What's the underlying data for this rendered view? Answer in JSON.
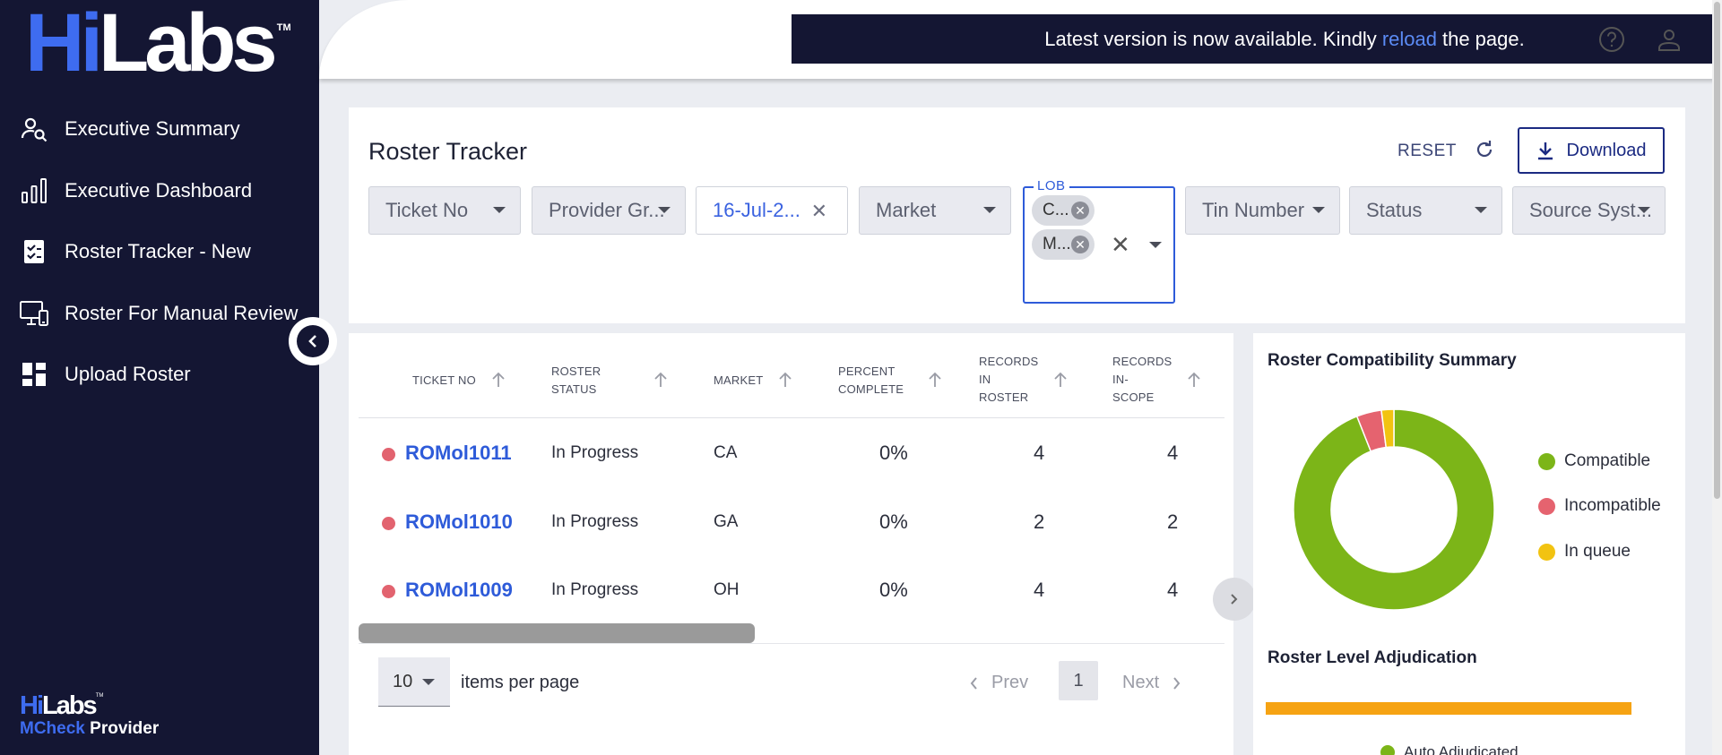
{
  "brand": {
    "logo_hi": "Hi",
    "logo_labs": "Labs",
    "logo_tm": "TM",
    "footer_hi": "Hi",
    "footer_labs": "Labs",
    "footer_tm": "TM",
    "footer_mcheck": "MCheck",
    "footer_provider": "Provider"
  },
  "sidebar": {
    "items": [
      {
        "label": "Executive Summary",
        "icon": "person-search-icon"
      },
      {
        "label": "Executive Dashboard",
        "icon": "bar-chart-icon"
      },
      {
        "label": "Roster Tracker - New",
        "icon": "checklist-icon"
      },
      {
        "label": "Roster For Manual Review",
        "icon": "monitor-icon"
      },
      {
        "label": "Upload Roster",
        "icon": "dashboard-grid-icon"
      }
    ]
  },
  "banner": {
    "text_before": "Latest version is now available. Kindly",
    "link": "reload",
    "text_after": "the page."
  },
  "page": {
    "title": "Roster Tracker",
    "reset_label": "RESET",
    "download_label": "Download"
  },
  "filters": {
    "ticket_no": "Ticket No",
    "provider_group": "Provider Gr...",
    "date": "16-Jul-2...",
    "market": "Market",
    "lob_label": "LOB",
    "lob_chips": [
      "C...",
      "M..."
    ],
    "tin_number": "Tin Number",
    "status": "Status",
    "source_system": "Source Syst..."
  },
  "table": {
    "headers": {
      "ticket_no": "TICKET NO",
      "roster_status_1": "ROSTER",
      "roster_status_2": "STATUS",
      "market": "MARKET",
      "percent_1": "PERCENT",
      "percent_2": "COMPLETE",
      "rec_roster_1": "RECORDS",
      "rec_roster_2": "IN",
      "rec_roster_3": "ROSTER",
      "rec_scope_1": "RECORDS",
      "rec_scope_2": "IN-",
      "rec_scope_3": "SCOPE"
    },
    "rows": [
      {
        "ticket": "ROMol1011",
        "status": "In Progress",
        "market": "CA",
        "percent": "0%",
        "records_in_roster": "4",
        "records_in_scope": "4"
      },
      {
        "ticket": "ROMol1010",
        "status": "In Progress",
        "market": "GA",
        "percent": "0%",
        "records_in_roster": "2",
        "records_in_scope": "2"
      },
      {
        "ticket": "ROMol1009",
        "status": "In Progress",
        "market": "OH",
        "percent": "0%",
        "records_in_roster": "4",
        "records_in_scope": "4"
      }
    ],
    "row_status_color": "#e2636f"
  },
  "pagination": {
    "page_size": "10",
    "items_per_page_label": "items per page",
    "prev_label": "Prev",
    "current_page": "1",
    "next_label": "Next"
  },
  "summary": {
    "compatibility_title": "Roster Compatibility Summary",
    "adjudication_title": "Roster Level Adjudication",
    "adjudication_legend": "Auto Adjudicated"
  },
  "chart_data": {
    "type": "pie",
    "donut": true,
    "categories": [
      "Compatible",
      "Incompatible",
      "In queue"
    ],
    "values": [
      94,
      4,
      2
    ],
    "colors": [
      "#7cb518",
      "#e5636f",
      "#f2c311"
    ]
  },
  "colors": {
    "sidebar_bg": "#141633",
    "accent": "#2e5bd9",
    "adjudication_bar": "#f6a313"
  }
}
